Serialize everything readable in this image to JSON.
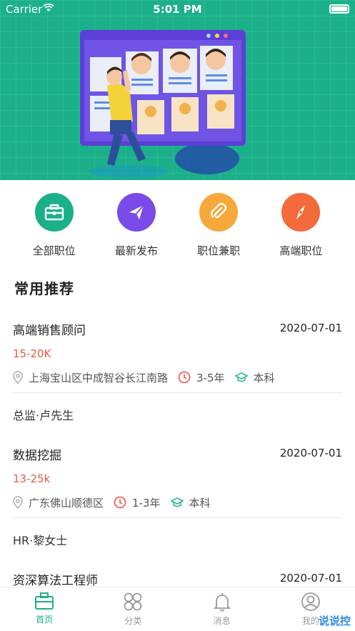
{
  "status_bar": {
    "carrier": "Carrier",
    "time": "5:01 PM"
  },
  "hero": {
    "colors": {
      "bg": "#1bb08a"
    }
  },
  "categories": [
    {
      "label": "全部职位",
      "icon": "briefcase-icon",
      "color": "#1bb08a"
    },
    {
      "label": "最新发布",
      "icon": "paper-plane-icon",
      "color": "#7a4be8"
    },
    {
      "label": "职位兼职",
      "icon": "paperclip-icon",
      "color": "#f7a83b"
    },
    {
      "label": "高端职位",
      "icon": "compass-icon",
      "color": "#f36a3b"
    }
  ],
  "section_title": "常用推荐",
  "jobs": [
    {
      "title": "高端销售顾问",
      "date": "2020-07-01",
      "salary": "15-20K",
      "location": "上海宝山区中成智谷长江南路",
      "experience": "3-5年",
      "education": "本科",
      "hr": "总监·卢先生"
    },
    {
      "title": "数据挖掘",
      "date": "2020-07-01",
      "salary": "13-25k",
      "location": "广东佛山顺德区",
      "experience": "1-3年",
      "education": "本科",
      "hr": "HR·黎女士"
    },
    {
      "title": "资深算法工程师",
      "date": "2020-07-01"
    }
  ],
  "tabbar": [
    {
      "label": "首页",
      "icon": "briefcase-icon",
      "active": true
    },
    {
      "label": "分类",
      "icon": "grid-icon",
      "active": false
    },
    {
      "label": "消息",
      "icon": "bell-icon",
      "active": false
    },
    {
      "label": "我的",
      "icon": "user-icon",
      "active": false
    }
  ],
  "watermark": "说说控",
  "colors": {
    "accent": "#1bb08a",
    "salary": "#e8583f"
  }
}
